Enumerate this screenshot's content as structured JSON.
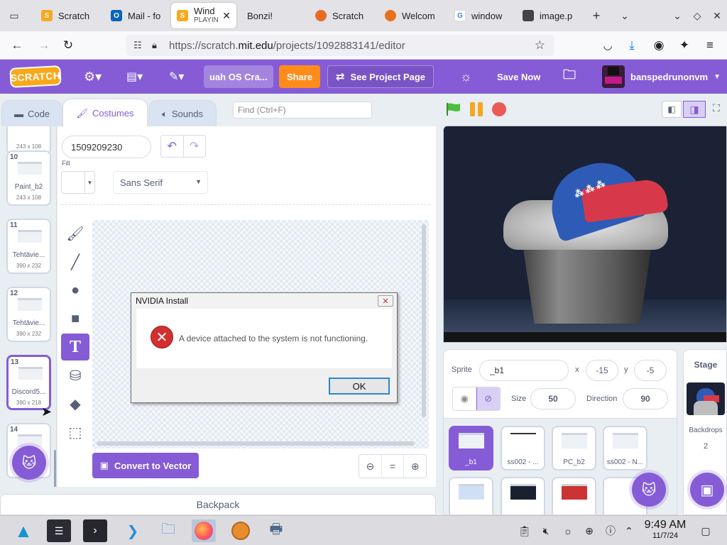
{
  "browser": {
    "tabs": [
      {
        "label": "Scratch"
      },
      {
        "label": "Mail - fo"
      },
      {
        "label": "Wind",
        "sub": "PLAYIN"
      },
      {
        "label": "Bonzi!"
      },
      {
        "label": "Scratch"
      },
      {
        "label": "Welcom"
      },
      {
        "label": "window"
      },
      {
        "label": "image.p"
      }
    ],
    "url_prefix": "https://scratch.",
    "url_domain": "mit.edu",
    "url_path": "/projects/1092883141/editor"
  },
  "menubar": {
    "logo": "SCRATCH",
    "project_title": "uah OS Cra...",
    "share": "Share",
    "see_project": "See Project Page",
    "save_now": "Save Now",
    "username": "banspedrunonvm"
  },
  "editor": {
    "tabs": {
      "code": "Code",
      "costumes": "Costumes",
      "sounds": "Sounds"
    },
    "find_placeholder": "Find (Ctrl+F)",
    "costumes": [
      {
        "num": "",
        "name": "",
        "size": "243 x 108"
      },
      {
        "num": "10",
        "name": "Paint_b2",
        "size": "243 x 108"
      },
      {
        "num": "11",
        "name": "Tehtävie...",
        "size": "390 x 232"
      },
      {
        "num": "12",
        "name": "Tehtävie...",
        "size": "390 x 232"
      },
      {
        "num": "13",
        "name": "Discord5...",
        "size": "390 x 218"
      },
      {
        "num": "14",
        "name": "",
        "size": ""
      }
    ],
    "costume_name": "1509209230",
    "fill_label": "Fill",
    "font": "Sans Serif",
    "convert": "Convert to Vector",
    "zoom": {
      "out": "⊖",
      "reset": "=",
      "in": "⊕"
    },
    "backpack": "Backpack"
  },
  "dialog": {
    "title": "NVIDIA Install",
    "message": "A device attached to the system is not functioning.",
    "ok": "OK"
  },
  "sprite": {
    "label": "Sprite",
    "name": "_b1",
    "x_label": "x",
    "x": "-15",
    "y_label": "y",
    "y": "-5",
    "size_label": "Size",
    "size": "50",
    "direction_label": "Direction",
    "direction": "90",
    "list": [
      {
        "name": "_b1"
      },
      {
        "name": "ss002 - ..."
      },
      {
        "name": "PC_b2"
      },
      {
        "name": "ss002 - N..."
      }
    ]
  },
  "stage_panel": {
    "title": "Stage",
    "backdrops_label": "Backdrops",
    "backdrops_count": "2"
  },
  "taskbar": {
    "time": "9:49 AM",
    "date": "11/7/24"
  },
  "colors": {
    "scratch_purple": "#855cd6",
    "share_orange": "#ff8c1a"
  }
}
